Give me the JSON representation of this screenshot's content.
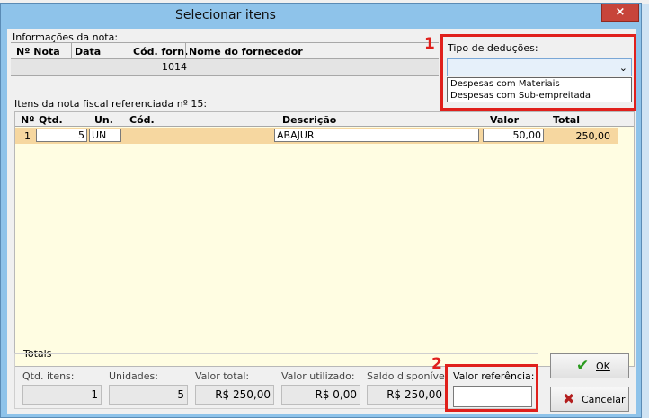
{
  "window": {
    "title": "Selecionar itens",
    "close_label": "×"
  },
  "nota": {
    "section_label": "Informações da nota:",
    "headers": {
      "numero": "Nº Nota",
      "data": "Data",
      "cod_forn": "Cód. forn.",
      "nome_forn": "Nome do fornecedor"
    },
    "row": {
      "numero": "",
      "data": "",
      "cod_forn": "1014",
      "nome_forn": ""
    }
  },
  "deducoes": {
    "marker": "1",
    "label": "Tipo de deduções:",
    "selected": "",
    "options": [
      "Despesas com Materiais",
      "Despesas com Sub-empreitada"
    ]
  },
  "itens": {
    "section_label": "Itens da nota fiscal referenciada nº 15:",
    "headers": {
      "num": "Nº",
      "qtd": "Qtd.",
      "un": "Un.",
      "cod": "Cód.",
      "descricao": "Descrição",
      "valor": "Valor",
      "total": "Total"
    },
    "rows": [
      {
        "num": "1",
        "qtd": "5",
        "un": "UN",
        "cod": "",
        "descricao": "ABAJUR",
        "valor": "50,00",
        "total": "250,00"
      }
    ]
  },
  "totais": {
    "section_label": "Totais",
    "marker": "2",
    "qtd_itens": {
      "label": "Qtd. itens:",
      "value": "1"
    },
    "unidades": {
      "label": "Unidades:",
      "value": "5"
    },
    "valor_total": {
      "label": "Valor total:",
      "value": "R$ 250,00"
    },
    "valor_utilizado": {
      "label": "Valor utilizado:",
      "value": "R$ 0,00"
    },
    "saldo": {
      "label": "Saldo disponível",
      "value": "R$ 250,00"
    },
    "valor_referencia": {
      "label": "Valor referência:",
      "value": ""
    }
  },
  "buttons": {
    "ok": "OK",
    "cancelar": "Cancelar"
  },
  "colors": {
    "accent": "#e0201c",
    "selected_row": "#f6d7a0",
    "grid_bg": "#fffde2"
  }
}
